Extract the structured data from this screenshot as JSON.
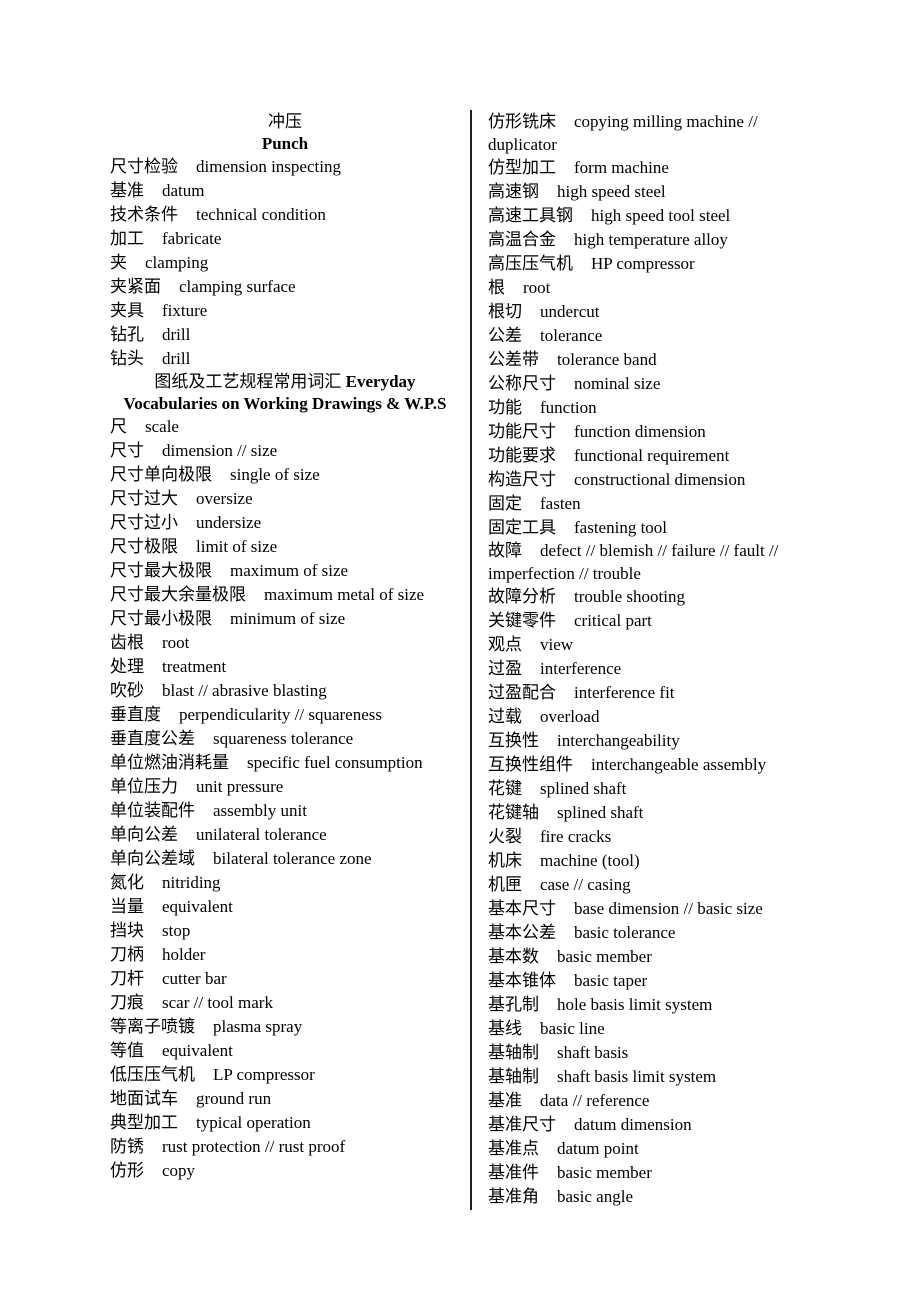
{
  "left_column": {
    "title_zh": "冲压",
    "title_en": "Punch",
    "entries_top": [
      {
        "zh": "尺寸检验",
        "en": "dimension inspecting"
      },
      {
        "zh": "基准",
        "en": "datum"
      },
      {
        "zh": "技术条件",
        "en": "technical condition"
      },
      {
        "zh": "加工",
        "en": "fabricate"
      },
      {
        "zh": "夹",
        "en": "clamping"
      },
      {
        "zh": "夹紧面",
        "en": "clamping surface"
      },
      {
        "zh": "夹具",
        "en": "fixture"
      },
      {
        "zh": "钻孔",
        "en": "drill"
      },
      {
        "zh": "钻头",
        "en": "drill"
      }
    ],
    "section_heading": {
      "zh": "图纸及工艺规程常用词汇",
      "en": "Everyday Vocabularies on Working Drawings & W.P.S"
    },
    "entries": [
      {
        "zh": "尺",
        "en": "scale"
      },
      {
        "zh": "尺寸",
        "en": "dimension // size"
      },
      {
        "zh": "尺寸单向极限",
        "en": "single of size"
      },
      {
        "zh": "尺寸过大",
        "en": "oversize"
      },
      {
        "zh": "尺寸过小",
        "en": "undersize"
      },
      {
        "zh": "尺寸极限",
        "en": "limit of size"
      },
      {
        "zh": "尺寸最大极限",
        "en": "maximum of size"
      },
      {
        "zh": "尺寸最大余量极限",
        "en": "maximum metal of size"
      },
      {
        "zh": "尺寸最小极限",
        "en": "minimum of size"
      },
      {
        "zh": "齿根",
        "en": "root"
      },
      {
        "zh": "处理",
        "en": "treatment"
      },
      {
        "zh": "吹砂",
        "en": "blast // abrasive blasting"
      },
      {
        "zh": "垂直度",
        "en": "perpendicularity // squareness"
      },
      {
        "zh": "垂直度公差",
        "en": "squareness tolerance"
      },
      {
        "zh": "单位燃油消耗量",
        "en": "specific fuel consumption"
      },
      {
        "zh": "单位压力",
        "en": "unit pressure"
      },
      {
        "zh": "单位装配件",
        "en": "assembly unit"
      },
      {
        "zh": "单向公差",
        "en": "unilateral tolerance"
      },
      {
        "zh": "单向公差域",
        "en": "bilateral tolerance zone"
      },
      {
        "zh": "氮化",
        "en": "nitriding"
      },
      {
        "zh": "当量",
        "en": "equivalent"
      },
      {
        "zh": "挡块",
        "en": "stop"
      },
      {
        "zh": "刀柄",
        "en": "holder"
      },
      {
        "zh": "刀杆",
        "en": "cutter bar"
      },
      {
        "zh": "刀痕",
        "en": "scar // tool mark"
      },
      {
        "zh": "等离子喷镀",
        "en": "plasma spray"
      },
      {
        "zh": "等值",
        "en": "equivalent"
      },
      {
        "zh": "低压压气机",
        "en": "LP compressor"
      },
      {
        "zh": "地面试车",
        "en": "ground run"
      },
      {
        "zh": "典型加工",
        "en": "typical operation"
      },
      {
        "zh": "防锈",
        "en": "rust protection // rust proof"
      },
      {
        "zh": "仿形",
        "en": "copy"
      }
    ]
  },
  "right_column": {
    "entries": [
      {
        "zh": "仿形铣床",
        "en": "copying milling machine // duplicator",
        "wrap": true
      },
      {
        "zh": "仿型加工",
        "en": "form machine"
      },
      {
        "zh": "高速钢",
        "en": "high speed steel"
      },
      {
        "zh": "高速工具钢",
        "en": "high speed tool steel"
      },
      {
        "zh": "高温合金",
        "en": "high temperature alloy"
      },
      {
        "zh": "高压压气机",
        "en": "HP compressor"
      },
      {
        "zh": "根",
        "en": "root"
      },
      {
        "zh": "根切",
        "en": "undercut"
      },
      {
        "zh": "公差",
        "en": "tolerance"
      },
      {
        "zh": "公差带",
        "en": "tolerance band"
      },
      {
        "zh": "公称尺寸",
        "en": "nominal size"
      },
      {
        "zh": "功能",
        "en": "function"
      },
      {
        "zh": "功能尺寸",
        "en": "function dimension"
      },
      {
        "zh": "功能要求",
        "en": "functional requirement"
      },
      {
        "zh": "构造尺寸",
        "en": "constructional dimension"
      },
      {
        "zh": "固定",
        "en": "fasten"
      },
      {
        "zh": "固定工具",
        "en": "fastening tool"
      },
      {
        "zh": "故障",
        "en": "defect // blemish // failure // fault // imperfection // trouble",
        "wrap": true
      },
      {
        "zh": "故障分析",
        "en": "trouble shooting"
      },
      {
        "zh": "关键零件",
        "en": "critical part"
      },
      {
        "zh": "观点",
        "en": "view"
      },
      {
        "zh": "过盈",
        "en": "interference"
      },
      {
        "zh": "过盈配合",
        "en": "interference fit"
      },
      {
        "zh": "过载",
        "en": "overload"
      },
      {
        "zh": "互换性",
        "en": "interchangeability"
      },
      {
        "zh": "互换性组件",
        "en": "interchangeable assembly"
      },
      {
        "zh": "花键",
        "en": "splined shaft"
      },
      {
        "zh": "花键轴",
        "en": "splined shaft"
      },
      {
        "zh": "火裂",
        "en": "fire cracks"
      },
      {
        "zh": "机床",
        "en": "machine (tool)"
      },
      {
        "zh": "机匣",
        "en": "case // casing"
      },
      {
        "zh": "基本尺寸",
        "en": "base dimension // basic size"
      },
      {
        "zh": "基本公差",
        "en": "basic tolerance"
      },
      {
        "zh": "基本数",
        "en": "basic member"
      },
      {
        "zh": "基本锥体",
        "en": "basic taper"
      },
      {
        "zh": "基孔制",
        "en": "hole basis limit system"
      },
      {
        "zh": "基线",
        "en": "basic line"
      },
      {
        "zh": "基轴制",
        "en": "shaft basis"
      },
      {
        "zh": "基轴制",
        "en": "shaft basis limit system"
      },
      {
        "zh": "基准",
        "en": "data // reference"
      },
      {
        "zh": "基准尺寸",
        "en": "datum dimension"
      },
      {
        "zh": "基准点",
        "en": "datum point"
      },
      {
        "zh": "基准件",
        "en": "basic member"
      },
      {
        "zh": "基准角",
        "en": "basic angle"
      }
    ]
  }
}
